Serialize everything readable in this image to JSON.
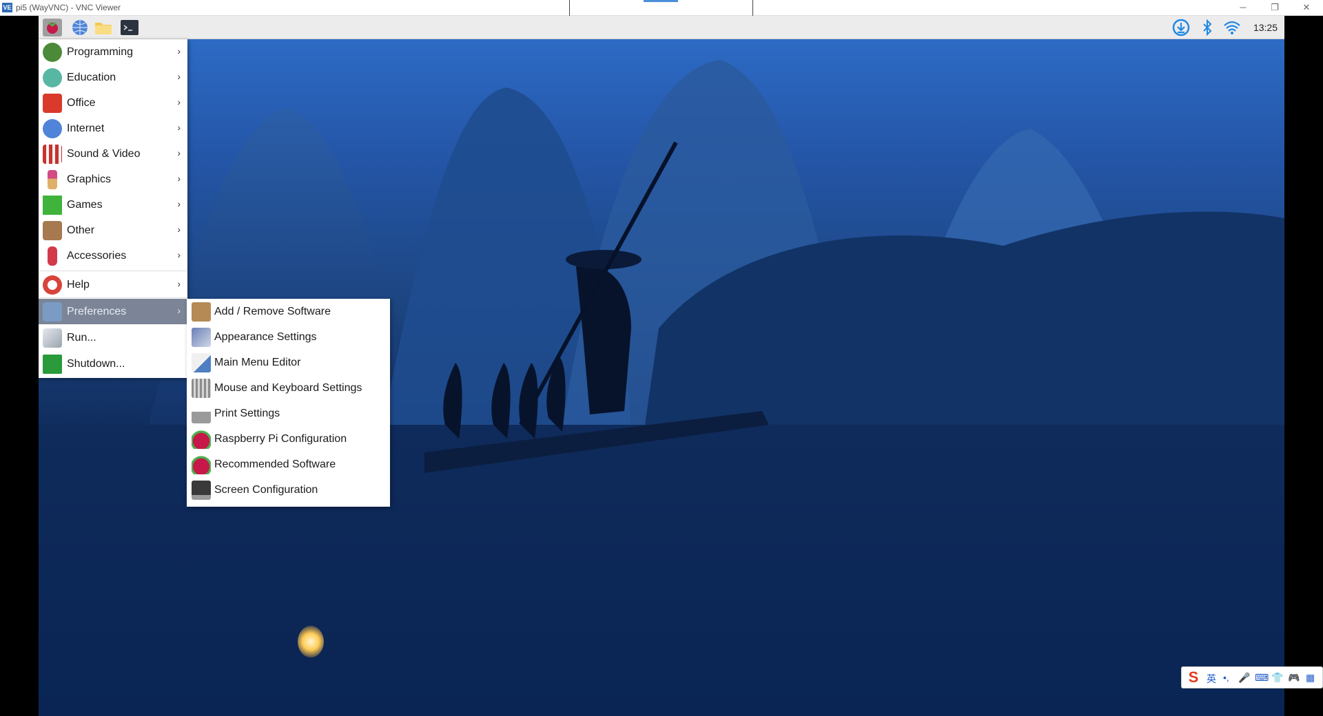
{
  "window": {
    "logo_text": "VE",
    "title": "pi5 (WayVNC) - VNC Viewer",
    "minimize_glyph": "─",
    "restore_glyph": "❐",
    "close_glyph": "✕"
  },
  "taskbar": {
    "clock": "13:25",
    "launchers": [
      "raspberry-menu-icon",
      "web-browser-icon",
      "file-manager-icon",
      "terminal-icon"
    ],
    "tray": [
      "updater-icon",
      "bluetooth-icon",
      "wifi-icon"
    ]
  },
  "main_menu": {
    "items": [
      {
        "label": "Programming",
        "icon": "programming-icon",
        "arrow": "›",
        "color": "#4c8a3a"
      },
      {
        "label": "Education",
        "icon": "education-icon",
        "arrow": "›",
        "color": "#58b7a3"
      },
      {
        "label": "Office",
        "icon": "office-icon",
        "arrow": "›",
        "color": "#d93a2b"
      },
      {
        "label": "Internet",
        "icon": "internet-icon",
        "arrow": "›",
        "color": "#4f84d8"
      },
      {
        "label": "Sound & Video",
        "icon": "sound-video-icon",
        "arrow": "›",
        "color": "#c9322d"
      },
      {
        "label": "Graphics",
        "icon": "graphics-icon",
        "arrow": "›",
        "color": "#d34a84"
      },
      {
        "label": "Games",
        "icon": "games-icon",
        "arrow": "›",
        "color": "#3fb33c"
      },
      {
        "label": "Other",
        "icon": "other-icon",
        "arrow": "›",
        "color": "#a7794e"
      },
      {
        "label": "Accessories",
        "icon": "accessories-icon",
        "arrow": "›",
        "color": "#d23a4a"
      },
      {
        "label": "Help",
        "icon": "help-icon",
        "arrow": "›",
        "color": "#d8433a"
      },
      {
        "label": "Preferences",
        "icon": "preferences-icon",
        "arrow": "›",
        "color": "#7a9bc4",
        "active": true
      },
      {
        "label": "Run...",
        "icon": "run-icon",
        "arrow": "",
        "color": "#9aa3ad"
      },
      {
        "label": "Shutdown...",
        "icon": "shutdown-icon",
        "arrow": "",
        "color": "#2a9a3a"
      }
    ]
  },
  "sub_menu": {
    "items": [
      {
        "label": "Add / Remove Software",
        "icon": "add-remove-software-icon",
        "color": "#b58a55"
      },
      {
        "label": "Appearance Settings",
        "icon": "appearance-settings-icon",
        "color": "#6a7fb5"
      },
      {
        "label": "Main Menu Editor",
        "icon": "main-menu-editor-icon",
        "color": "#4d7fc2"
      },
      {
        "label": "Mouse and Keyboard Settings",
        "icon": "mouse-keyboard-icon",
        "color": "#8c8c8c"
      },
      {
        "label": "Print Settings",
        "icon": "print-settings-icon",
        "color": "#9a9a9a"
      },
      {
        "label": "Raspberry Pi Configuration",
        "icon": "raspberry-pi-config-icon",
        "color": "#c7184a"
      },
      {
        "label": "Recommended Software",
        "icon": "recommended-software-icon",
        "color": "#c7184a"
      },
      {
        "label": "Screen Configuration",
        "icon": "screen-configuration-icon",
        "color": "#3a3a3a"
      }
    ]
  },
  "ime": {
    "logo": "S",
    "glyphs": [
      "英",
      "•,",
      "🎤",
      "⌨",
      "👕",
      "🎮",
      "▦"
    ]
  }
}
